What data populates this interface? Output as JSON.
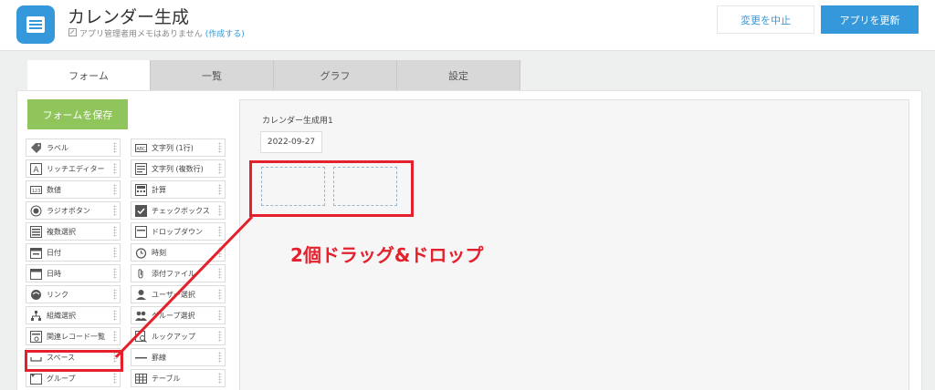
{
  "header": {
    "app_title": "カレンダー生成",
    "memo_text": "アプリ管理者用メモはありません",
    "memo_link": "(作成する)",
    "cancel_label": "変更を中止",
    "update_label": "アプリを更新"
  },
  "tabs": [
    {
      "label": "フォーム",
      "active": true
    },
    {
      "label": "一覧",
      "active": false
    },
    {
      "label": "グラフ",
      "active": false
    },
    {
      "label": "設定",
      "active": false
    }
  ],
  "palette": {
    "save_label": "フォームを保存",
    "left": [
      {
        "label": "ラベル",
        "icon": "tag-icon"
      },
      {
        "label": "リッチエディター",
        "icon": "rich-editor-icon"
      },
      {
        "label": "数値",
        "icon": "number-icon"
      },
      {
        "label": "ラジオボタン",
        "icon": "radio-icon"
      },
      {
        "label": "複数選択",
        "icon": "multi-select-icon"
      },
      {
        "label": "日付",
        "icon": "date-icon"
      },
      {
        "label": "日時",
        "icon": "datetime-icon"
      },
      {
        "label": "リンク",
        "icon": "link-icon"
      },
      {
        "label": "組織選択",
        "icon": "org-icon"
      },
      {
        "label": "関連レコード一覧",
        "icon": "related-records-icon"
      },
      {
        "label": "スペース",
        "icon": "space-icon"
      },
      {
        "label": "グループ",
        "icon": "group-icon"
      }
    ],
    "right": [
      {
        "label": "文字列 (1行)",
        "icon": "text-single-icon"
      },
      {
        "label": "文字列 (複数行)",
        "icon": "text-multi-icon"
      },
      {
        "label": "計算",
        "icon": "calc-icon"
      },
      {
        "label": "チェックボックス",
        "icon": "checkbox-icon"
      },
      {
        "label": "ドロップダウン",
        "icon": "dropdown-icon"
      },
      {
        "label": "時刻",
        "icon": "clock-icon"
      },
      {
        "label": "添付ファイル",
        "icon": "attachment-icon"
      },
      {
        "label": "ユーザー選択",
        "icon": "user-icon"
      },
      {
        "label": "グループ選択",
        "icon": "users-icon"
      },
      {
        "label": "ルックアップ",
        "icon": "lookup-icon"
      },
      {
        "label": "罫線",
        "icon": "line-icon"
      },
      {
        "label": "テーブル",
        "icon": "table-icon"
      }
    ]
  },
  "form": {
    "field_label": "カレンダー生成用1",
    "field_value": "2022-09-27"
  },
  "annotation": "2個ドラッグ&ドロップ",
  "colors": {
    "accent": "#3498db",
    "save": "#8fc55b",
    "highlight": "#e3202b"
  }
}
